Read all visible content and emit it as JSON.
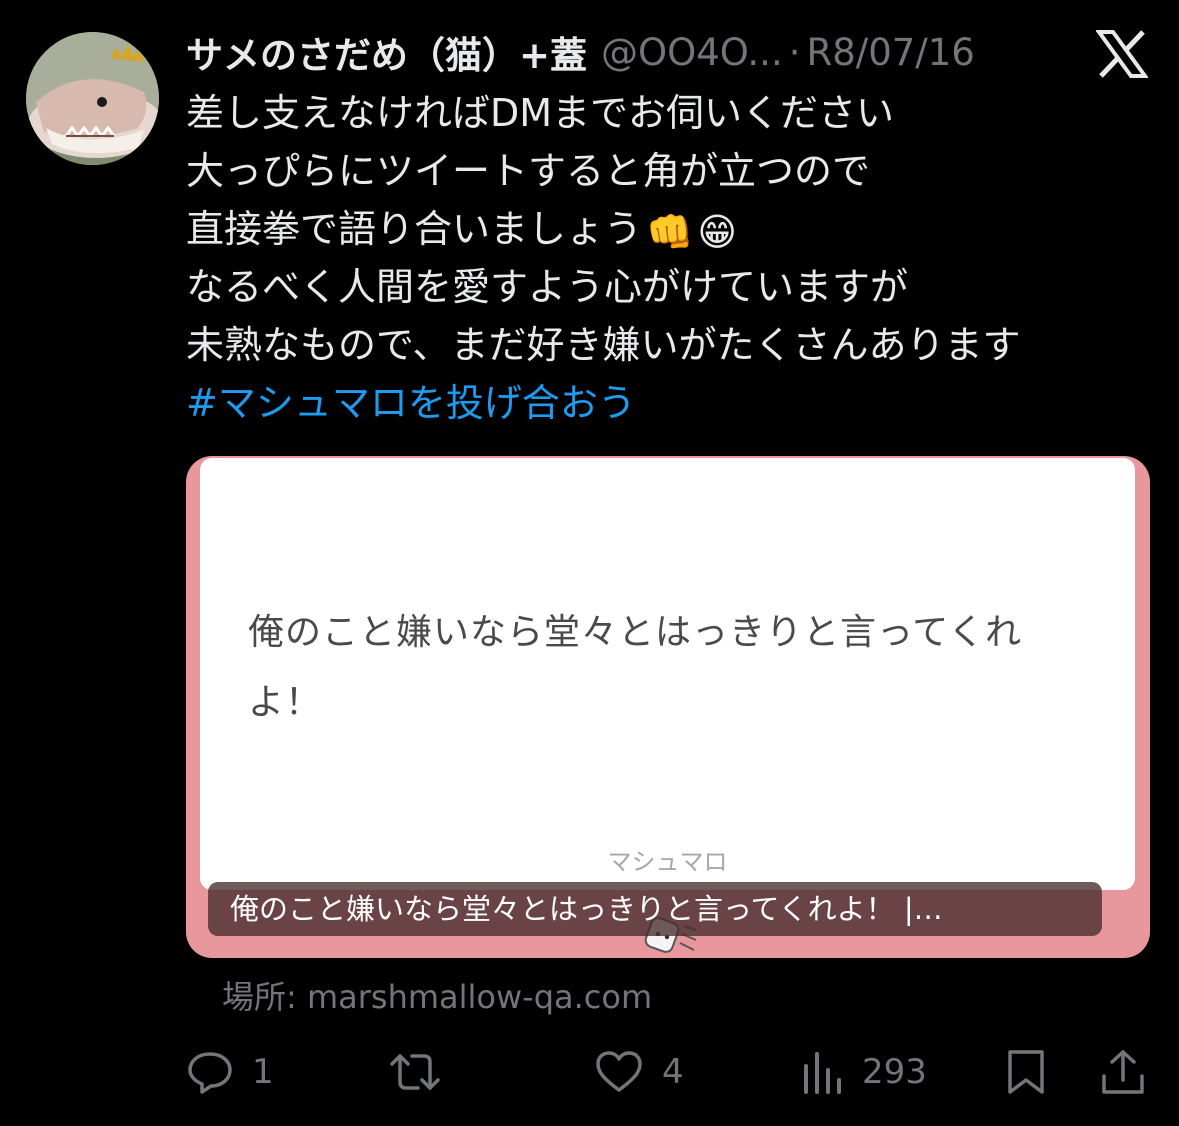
{
  "author": {
    "display_name": "サメのさだめ（猫）+蓋",
    "handle": "@OO4O...",
    "separator": "·",
    "date": "R8/07/16"
  },
  "tweet": {
    "lines": [
      "差し支えなければDMまでお伺いください",
      "大っぴらにツイートすると角が立つので",
      "直接拳で語り合いましょう",
      "なるべく人間を愛すよう心がけていますが",
      "未熟なもので、まだ好き嫌いがたくさんあります"
    ],
    "emojis": [
      "👊",
      "😁"
    ],
    "hashtag": "#マシュマロを投げ合おう"
  },
  "card": {
    "question": "俺のこと嫌いなら堂々とはっきりと言ってくれよ！",
    "brand": "マシュマロ",
    "caption": "俺のこと嫌いなら堂々とはっきりと言ってくれよ！ |…",
    "source": "場所: marshmallow-qa.com"
  },
  "actions": {
    "reply_count": "1",
    "retweet_count": "",
    "like_count": "4",
    "view_count": "293"
  },
  "icons": {
    "logo": "x-logo-icon",
    "reply": "reply-icon",
    "retweet": "retweet-icon",
    "like": "heart-icon",
    "views": "views-icon",
    "bookmark": "bookmark-icon",
    "share": "share-icon"
  },
  "colors": {
    "background": "#000000",
    "text": "#e7e9ea",
    "muted": "#71767b",
    "link": "#1d9bf0",
    "card_frame": "#e8989c"
  }
}
